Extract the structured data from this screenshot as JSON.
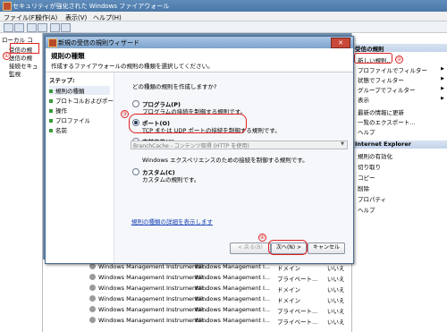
{
  "window": {
    "title": "セキュリティが強化された Windows ファイアウォール"
  },
  "menu": [
    "ファイル(F)",
    "操作(A)",
    "表示(V)",
    "ヘルプ(H)"
  ],
  "left_tree": [
    "ローカル コ",
    "受信の規",
    "送信の規",
    "接続セキュ",
    "監視"
  ],
  "markers": {
    "m1": "①",
    "m2": "②",
    "m3": "③",
    "m4": "④"
  },
  "right_panel": {
    "section1": "受信の規則",
    "section1_items": [
      "新しい規則...",
      "プロファイルでフィルター",
      "状態でフィルター",
      "グループでフィルター",
      "表示",
      "最新の情報に更新",
      "一覧のエクスポート...",
      "ヘルプ"
    ],
    "section2": "Internet Explorer",
    "section2_items": [
      "規則の有効化",
      "切り取り",
      "コピー",
      "削除",
      "プロパティ",
      "ヘルプ"
    ]
  },
  "table_rows": [
    {
      "name": "Windows Management Instrumentat...",
      "group": "Windows Management I...",
      "profile": "ドメイン",
      "enabled": "いいえ"
    },
    {
      "name": "Windows Management Instrumentat...",
      "group": "Windows Management I...",
      "profile": "プライベート...",
      "enabled": "いいえ"
    },
    {
      "name": "Windows Management Instrumentat...",
      "group": "Windows Management I...",
      "profile": "ドメイン",
      "enabled": "いいえ"
    },
    {
      "name": "Windows Management Instrumentat...",
      "group": "Windows Management I...",
      "profile": "ドメイン",
      "enabled": "いいえ"
    },
    {
      "name": "Windows Management Instrumentat...",
      "group": "Windows Management I...",
      "profile": "プライベート...",
      "enabled": "いいえ"
    },
    {
      "name": "Windows Management Instrumentat...",
      "group": "Windows Management I...",
      "profile": "プライベート...",
      "enabled": "いいえ"
    }
  ],
  "wizard": {
    "title": "新規の受信の規則ウィザード",
    "close": "✕",
    "header_title": "規則の種類",
    "header_desc": "作成するファイアウォールの規則の種類を選択してください。",
    "steps_label": "ステップ:",
    "steps": [
      "規則の種類",
      "プロトコルおよびポート",
      "操作",
      "プロファイル",
      "名前"
    ],
    "question": "どの種類の規則を作成しますか?",
    "options": [
      {
        "label": "プログラム(P)",
        "desc": "プログラムの接続を制御する規則です。"
      },
      {
        "label": "ポート(O)",
        "desc": "TCP または UDP ポートの接続を制御する規則です。"
      },
      {
        "label": "事前定義(E):",
        "desc": "Windows エクスペリエンスのための接続を制御する規則です。"
      },
      {
        "label": "カスタム(C)",
        "desc": "カスタムの規則です。"
      }
    ],
    "predefined_value": "BranchCache - コンテンツ取得 (HTTP を使用)",
    "help_link": "規則の種類の詳細を表示します",
    "back": "< 戻る(B)",
    "next": "次へ(N) >",
    "cancel": "キャンセル"
  }
}
